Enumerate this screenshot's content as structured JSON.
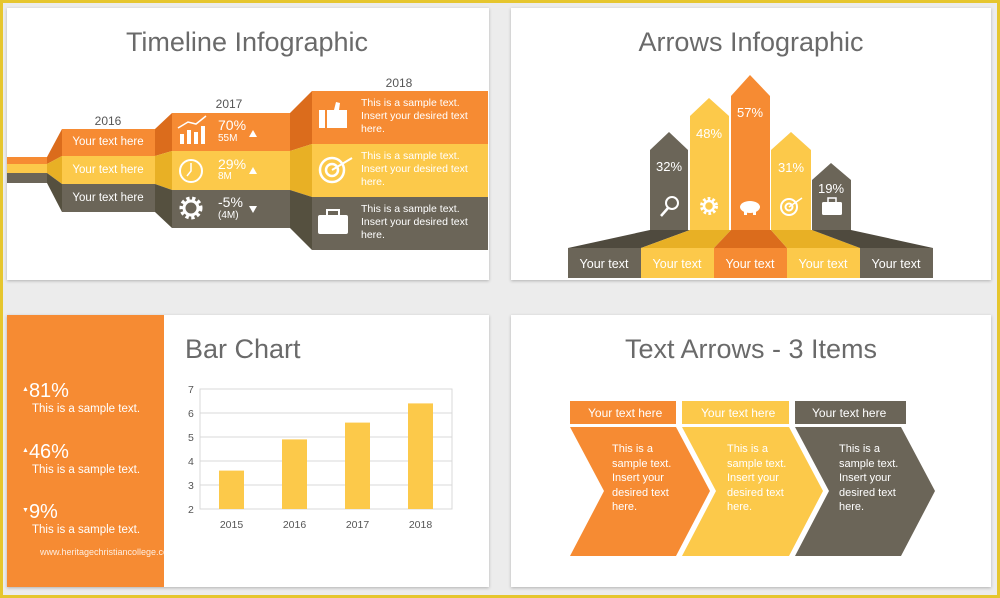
{
  "colors": {
    "orange": "#f68b33",
    "yellow": "#fcc94a",
    "dark": "#6b6558",
    "frame": "#e6c62e"
  },
  "timeline": {
    "title": "Timeline Infographic",
    "years": [
      "2016",
      "2017",
      "2018"
    ],
    "col2016": [
      "Your text here",
      "Your text here",
      "Your text here"
    ],
    "col2017": [
      {
        "icon": "bar-chart-icon",
        "value": "70%",
        "sub": "55M",
        "trend": "up"
      },
      {
        "icon": "clock-icon",
        "value": "29%",
        "sub": "8M",
        "trend": "up"
      },
      {
        "icon": "gear-icon",
        "value": "-5%",
        "sub": "(4M)",
        "trend": "down"
      }
    ],
    "col2018": [
      {
        "icon": "thumbs-up-icon",
        "text": "This is a sample text. Insert your desired text here."
      },
      {
        "icon": "target-icon",
        "text": "This is a sample text. Insert your desired text here."
      },
      {
        "icon": "briefcase-icon",
        "text": "This is a sample text. Insert your desired text here."
      }
    ]
  },
  "arrows": {
    "title": "Arrows Infographic",
    "items": [
      {
        "pct": "32%",
        "icon": "magnifier-icon",
        "label": "Your text",
        "color": "dark"
      },
      {
        "pct": "48%",
        "icon": "gear-icon",
        "label": "Your text",
        "color": "yellow"
      },
      {
        "pct": "57%",
        "icon": "piggy-bank-icon",
        "label": "Your text",
        "color": "orange"
      },
      {
        "pct": "31%",
        "icon": "target-icon",
        "label": "Your text",
        "color": "yellow"
      },
      {
        "pct": "19%",
        "icon": "briefcase-icon",
        "label": "Your text",
        "color": "dark"
      }
    ]
  },
  "barchart": {
    "title": "Bar Chart",
    "stats": [
      {
        "value": "81%",
        "trend": "up",
        "text": "This is a sample text."
      },
      {
        "value": "46%",
        "trend": "up",
        "text": "This is a sample text."
      },
      {
        "value": "9%",
        "trend": "down",
        "text": "This is a sample text."
      }
    ],
    "watermark": "www.heritagechristiancollege.com"
  },
  "chart_data": {
    "type": "bar",
    "categories": [
      "2015",
      "2016",
      "2017",
      "2018"
    ],
    "values": [
      3.6,
      4.9,
      5.6,
      6.4
    ],
    "yticks": [
      "2",
      "3",
      "4",
      "5",
      "6",
      "7"
    ],
    "ylim": [
      2,
      7
    ],
    "grid": true,
    "color": "#fcc94a"
  },
  "textarrows": {
    "title": "Text Arrows - 3 Items",
    "items": [
      {
        "header": "Your text here",
        "body": "This is a sample text. Insert your desired text here.",
        "color": "orange"
      },
      {
        "header": "Your text here",
        "body": "This is a sample text. Insert your desired text here.",
        "color": "yellow"
      },
      {
        "header": "Your text here",
        "body": "This is a sample text. Insert your desired text here.",
        "color": "dark"
      }
    ]
  }
}
